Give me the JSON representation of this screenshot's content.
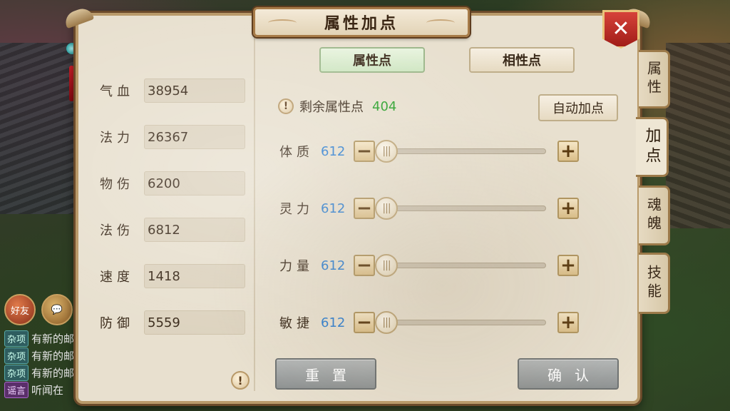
{
  "window": {
    "title": "属性加点",
    "close_label": "✕"
  },
  "stats": [
    {
      "label": "气血",
      "value": "38954"
    },
    {
      "label": "法力",
      "value": "26367"
    },
    {
      "label": "物伤",
      "value": "6200"
    },
    {
      "label": "法伤",
      "value": "6812"
    },
    {
      "label": "速度",
      "value": "1418"
    },
    {
      "label": "防御",
      "value": "5559"
    }
  ],
  "tabs": {
    "attribute_points": "属性点",
    "affinity_points": "相性点"
  },
  "remaining": {
    "label": "剩余属性点",
    "value": "404"
  },
  "auto_button": "自动加点",
  "attributes": [
    {
      "label": "体质",
      "value": "612",
      "slider_fraction": 0.0
    },
    {
      "label": "灵力",
      "value": "612",
      "slider_fraction": 0.0
    },
    {
      "label": "力量",
      "value": "612",
      "slider_fraction": 0.0
    },
    {
      "label": "敏捷",
      "value": "612",
      "slider_fraction": 0.0
    }
  ],
  "buttons": {
    "reset": "重置",
    "confirm": "确认",
    "minus": "−",
    "plus": "+",
    "info": "!"
  },
  "side_tabs": [
    {
      "label": "属性",
      "active": false
    },
    {
      "label": "加点",
      "active": true
    },
    {
      "label": "魂魄",
      "active": false
    },
    {
      "label": "技能",
      "active": false
    }
  ],
  "chat": {
    "friend_icon_label": "好友",
    "lines": [
      {
        "tag": "杂项",
        "text": "有新的邮"
      },
      {
        "tag": "杂项",
        "text": "有新的邮"
      },
      {
        "tag": "杂项",
        "text": "有新的邮"
      },
      {
        "tag": "谣言",
        "text": "听闻在"
      }
    ]
  },
  "colors": {
    "value_blue": "#2f7fd0",
    "remain_green": "#2aa02a",
    "close_red": "#c22a24"
  }
}
